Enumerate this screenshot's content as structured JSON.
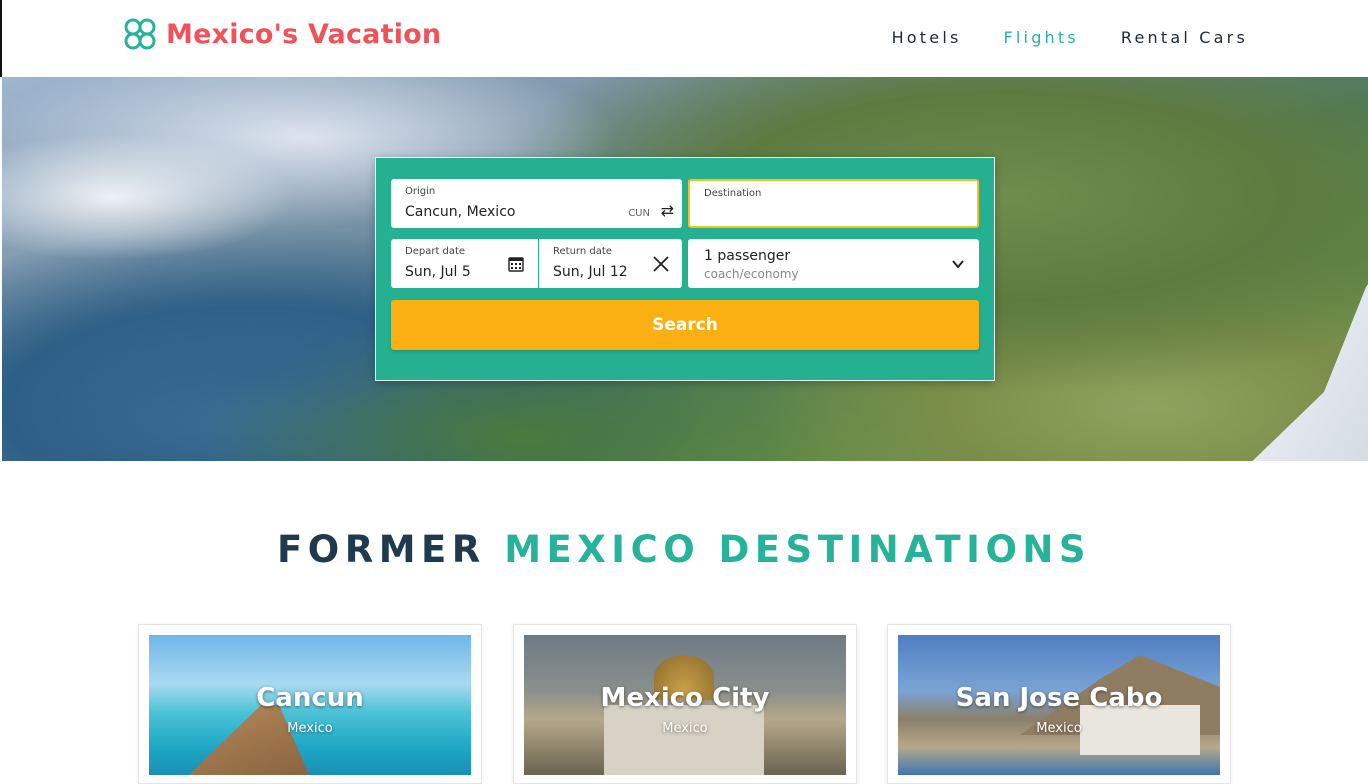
{
  "brand": {
    "name": "Mexico's Vacation",
    "color": "#f0525a",
    "accent": "#27b39a"
  },
  "nav": {
    "items": [
      {
        "label": "Hotels",
        "active": false
      },
      {
        "label": "Flights",
        "active": true
      },
      {
        "label": "Rental Cars",
        "active": false
      }
    ]
  },
  "search": {
    "origin_label": "Origin",
    "origin_value": "Cancun, Mexico",
    "origin_code": "CUN",
    "destination_label": "Destination",
    "destination_value": "",
    "depart_label": "Depart date",
    "depart_value": "Sun, Jul 5",
    "return_label": "Return date",
    "return_value": "Sun, Jul 12",
    "passengers": "1 passenger",
    "cabin": "coach/economy",
    "button_label": "Search",
    "panel_color": "#25b091",
    "button_color": "#fab012"
  },
  "section": {
    "title_part1": "FORMER",
    "title_part2": "MEXICO DESTINATIONS"
  },
  "destinations": [
    {
      "name": "Cancun",
      "country": "Mexico"
    },
    {
      "name": "Mexico City",
      "country": "Mexico"
    },
    {
      "name": "San Jose Cabo",
      "country": "Mexico"
    }
  ]
}
